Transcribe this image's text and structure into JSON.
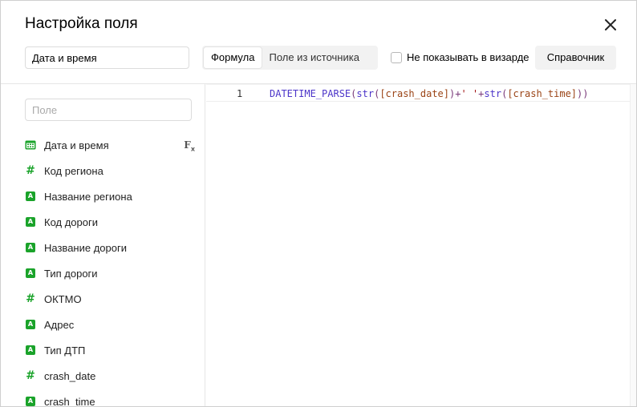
{
  "dialog": {
    "title": "Настройка поля",
    "field_name_value": "Дата и время",
    "close_icon": "close-icon"
  },
  "mode_tabs": [
    {
      "label": "Формула",
      "active": true
    },
    {
      "label": "Поле из источника",
      "active": false
    }
  ],
  "hide_in_wizard": {
    "label": "Не показывать в визарде",
    "checked": false
  },
  "reference_button": "Справочник",
  "sidebar": {
    "search_placeholder": "Поле",
    "fields": [
      {
        "label": "Дата и время",
        "type": "datetime",
        "icon": "calendar-icon",
        "formula": true
      },
      {
        "label": "Код региона",
        "type": "number",
        "icon": "hash-icon"
      },
      {
        "label": "Название региона",
        "type": "string",
        "icon": "string-icon"
      },
      {
        "label": "Код дороги",
        "type": "string",
        "icon": "string-icon"
      },
      {
        "label": "Название дороги",
        "type": "string",
        "icon": "string-icon"
      },
      {
        "label": "Тип дороги",
        "type": "string",
        "icon": "string-icon"
      },
      {
        "label": "ОКТМО",
        "type": "number",
        "icon": "hash-icon"
      },
      {
        "label": "Адрес",
        "type": "string",
        "icon": "string-icon"
      },
      {
        "label": "Тип ДТП",
        "type": "string",
        "icon": "string-icon"
      },
      {
        "label": "crash_date",
        "type": "number",
        "icon": "hash-icon"
      },
      {
        "label": "crash_time",
        "type": "string",
        "icon": "string-icon"
      }
    ],
    "string_icon_glyph": "A",
    "number_icon_glyph": "#",
    "formula_icon_label": "F"
  },
  "editor": {
    "line_number": "1",
    "tokens": [
      {
        "t": "DATETIME_PARSE",
        "k": "fn"
      },
      {
        "t": "(",
        "k": "punc"
      },
      {
        "t": "str",
        "k": "fn"
      },
      {
        "t": "(",
        "k": "punc"
      },
      {
        "t": "[crash_date]",
        "k": "field"
      },
      {
        "t": ")",
        "k": "punc"
      },
      {
        "t": "+",
        "k": "punc"
      },
      {
        "t": "' '",
        "k": "str"
      },
      {
        "t": "+",
        "k": "punc"
      },
      {
        "t": "str",
        "k": "fn"
      },
      {
        "t": "(",
        "k": "punc"
      },
      {
        "t": "[crash_time]",
        "k": "field"
      },
      {
        "t": "))",
        "k": "punc"
      }
    ]
  },
  "colors": {
    "accent_green": "#1aa32a",
    "code_function": "#4c35c9",
    "code_field": "#9b4416",
    "code_string": "#a31515"
  }
}
